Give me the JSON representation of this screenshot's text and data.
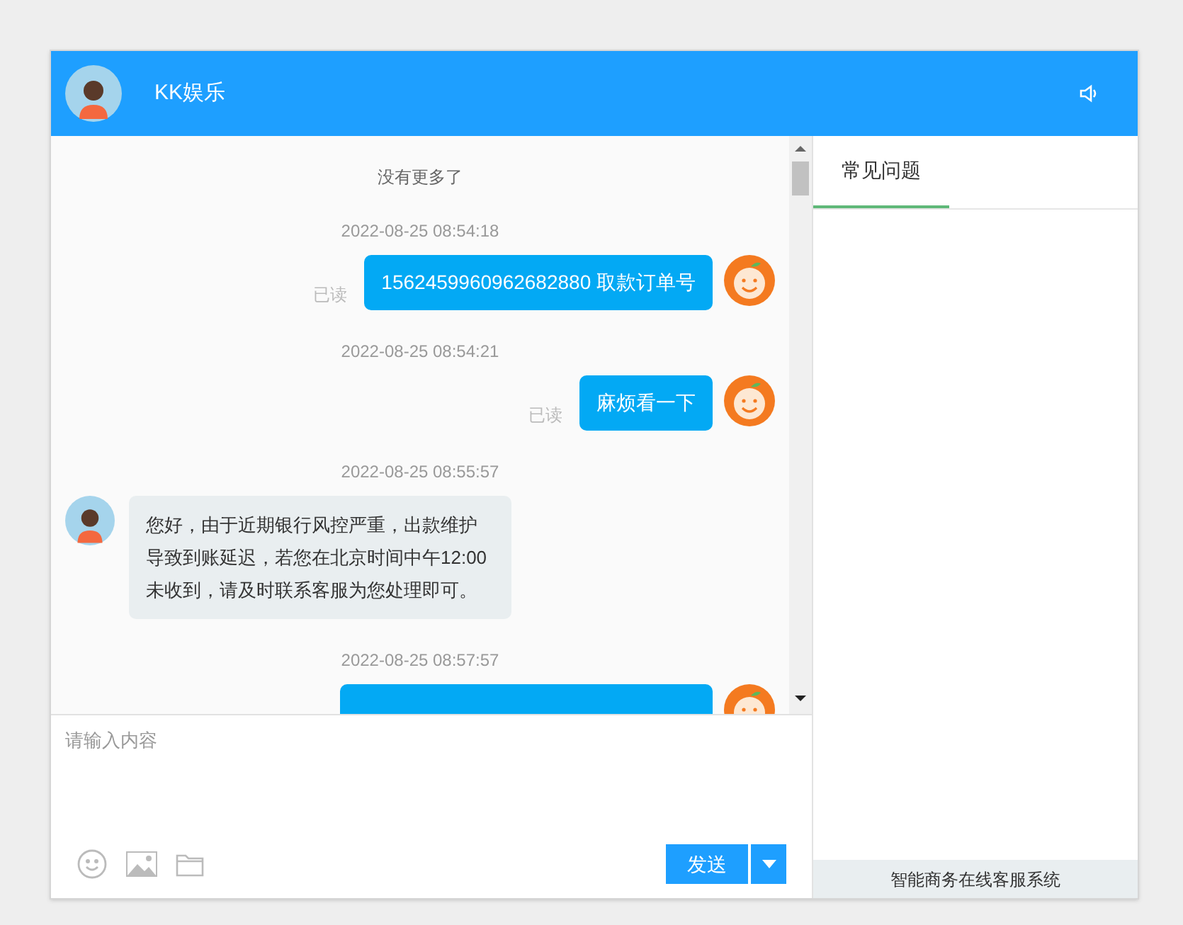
{
  "header": {
    "title": "KK娱乐"
  },
  "chat": {
    "no_more": "没有更多了",
    "messages": [
      {
        "kind": "self",
        "time": "2022-08-25 08:54:18",
        "text": "1562459960962682880 取款订单号",
        "status": "已读"
      },
      {
        "kind": "self",
        "time": "2022-08-25 08:54:21",
        "text": "麻烦看一下",
        "status": "已读"
      },
      {
        "kind": "agent",
        "time": "2022-08-25 08:55:57",
        "text": "您好，由于近期银行风控严重，出款维护导致到账延迟，若您在北京时间中午12:00未收到，请及时联系客服为您处理即可。"
      },
      {
        "kind": "self",
        "time": "2022-08-25 08:57:57"
      }
    ]
  },
  "composer": {
    "placeholder": "请输入内容",
    "send": "发送"
  },
  "side": {
    "tabs": [
      {
        "label": "常见问题",
        "selected": true
      }
    ],
    "footer": "智能商务在线客服系统"
  }
}
